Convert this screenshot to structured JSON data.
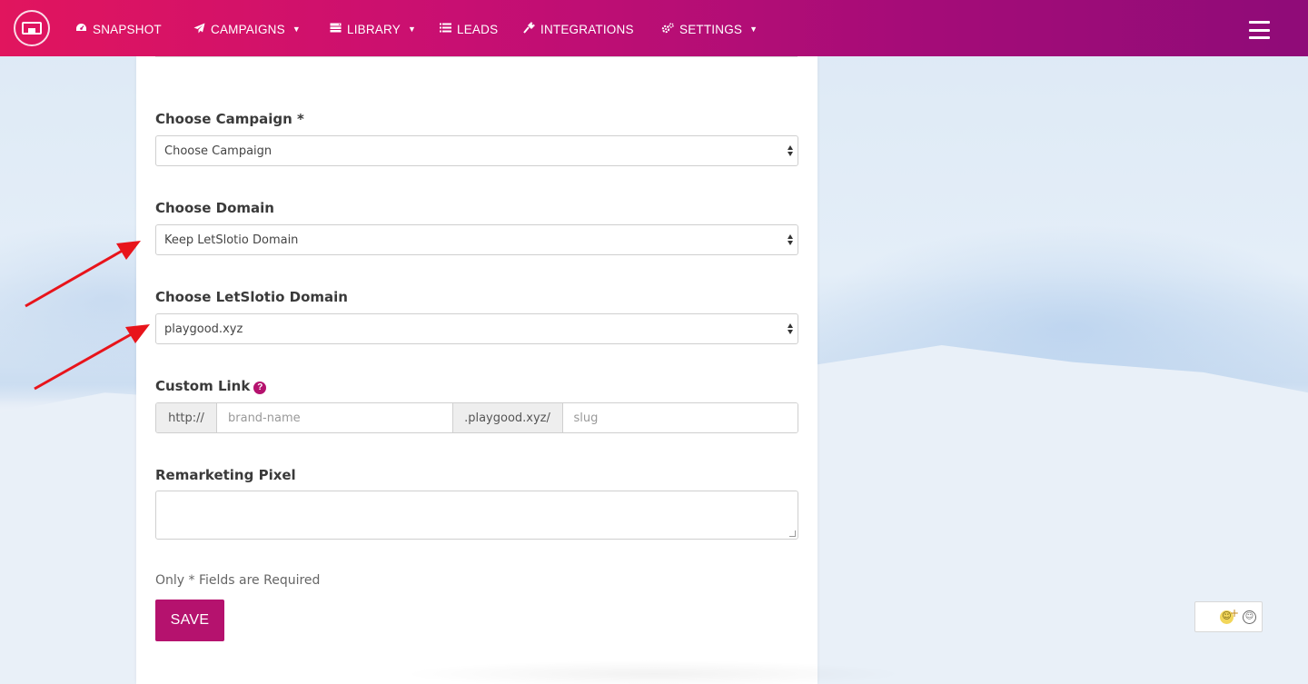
{
  "nav": {
    "items": [
      {
        "label": "SNAPSHOT",
        "icon": "dashboard-icon"
      },
      {
        "label": "CAMPAIGNS",
        "icon": "paper-plane-icon",
        "dropdown": true
      },
      {
        "label": "LIBRARY",
        "icon": "server-icon",
        "dropdown": true
      },
      {
        "label": "LEADS",
        "icon": "list-icon"
      },
      {
        "label": "INTEGRATIONS",
        "icon": "plug-icon"
      },
      {
        "label": "SETTINGS",
        "icon": "cogs-icon",
        "dropdown": true
      }
    ],
    "menu_icon": "hamburger-icon",
    "logo_icon": "logo-icon"
  },
  "form": {
    "campaign": {
      "label": "Choose Campaign *",
      "value": "Choose Campaign"
    },
    "domain": {
      "label": "Choose Domain",
      "value": "Keep LetSlotio Domain"
    },
    "letslotio_domain": {
      "label": "Choose LetSlotio Domain",
      "value": "playgood.xyz"
    },
    "custom_link": {
      "label": "Custom Link",
      "prefix": "http://",
      "brand_placeholder": "brand-name",
      "domain_suffix": ".playgood.xyz/",
      "slug_placeholder": "slug"
    },
    "remarketing_pixel": {
      "label": "Remarketing Pixel",
      "value": ""
    },
    "required_note": "Only * Fields are Required",
    "save_label": "SAVE"
  },
  "colors": {
    "nav_gradient_start": "#e1155e",
    "nav_gradient_end": "#8f0b78",
    "accent": "#b5126e",
    "annotation_arrow": "#e8141b"
  }
}
